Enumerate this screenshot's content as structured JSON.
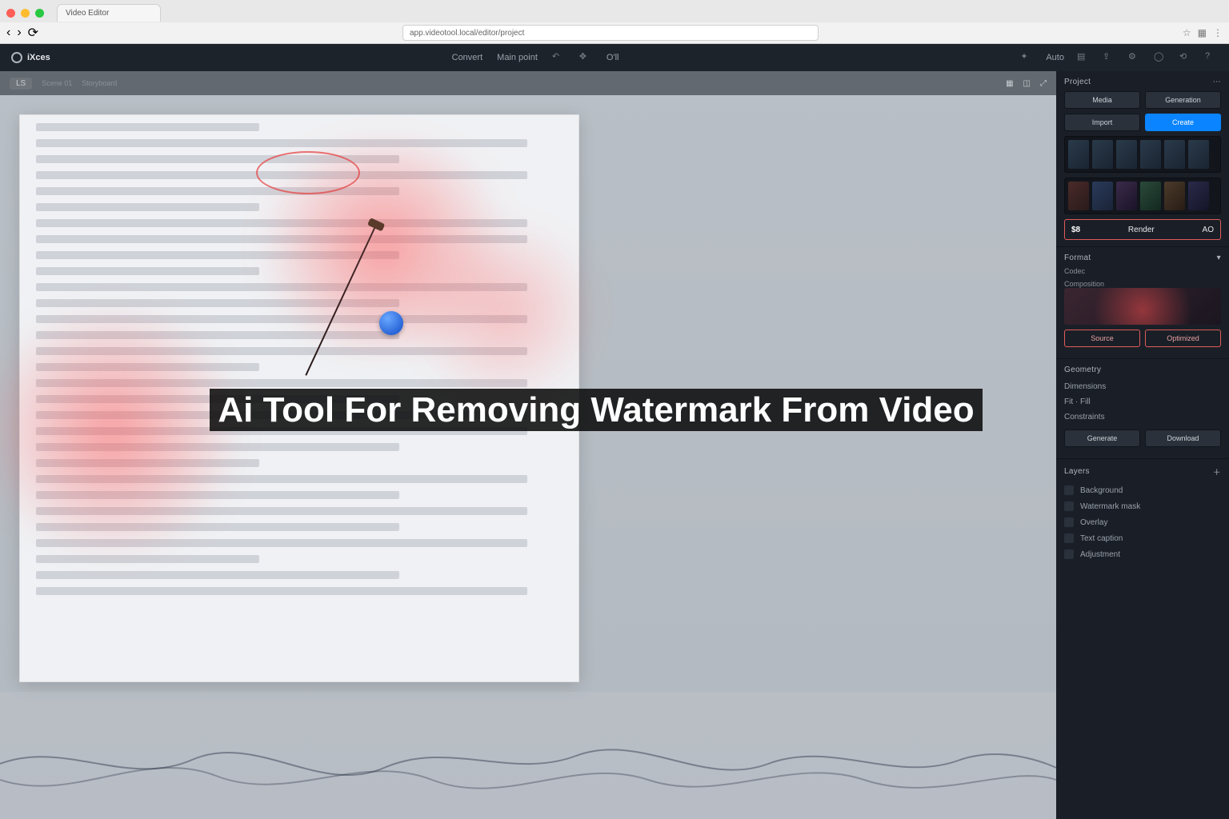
{
  "browser": {
    "tab_title": "Video Editor",
    "address": "app.videotool.local/editor/project"
  },
  "topbar": {
    "app_name": "iXces",
    "menu_center_1": "Convert",
    "menu_center_2": "Main point",
    "status_indicator": "O'll",
    "menu_right_1": "Auto"
  },
  "secondary": {
    "tab_label": "LS",
    "crumb_1": "Scene 01",
    "crumb_2": "Storyboard"
  },
  "overlay_title": "Ai Tool For Removing Watermark From Video",
  "panel": {
    "top": {
      "header": "Project",
      "tab_a": "Media",
      "tab_b": "Generation",
      "btn_left": "Import",
      "btn_right": "Create",
      "price_currency": "$8",
      "price_label": "Render",
      "price_action": "AO"
    },
    "format": {
      "header": "Format",
      "sub_a": "Codec",
      "sub_b": "Composition",
      "opt_a": "Source",
      "opt_b": "Optimized",
      "btn_generate": "Generate",
      "btn_download": "Download"
    },
    "geometry": {
      "header": "Geometry",
      "row_1": "Dimensions",
      "row_2": "Fit · Fill",
      "row_3": "Constraints"
    },
    "layers": {
      "header": "Layers",
      "item_1": "Background",
      "item_2": "Watermark mask",
      "item_3": "Overlay",
      "item_4": "Text caption",
      "item_5": "Adjustment"
    }
  }
}
